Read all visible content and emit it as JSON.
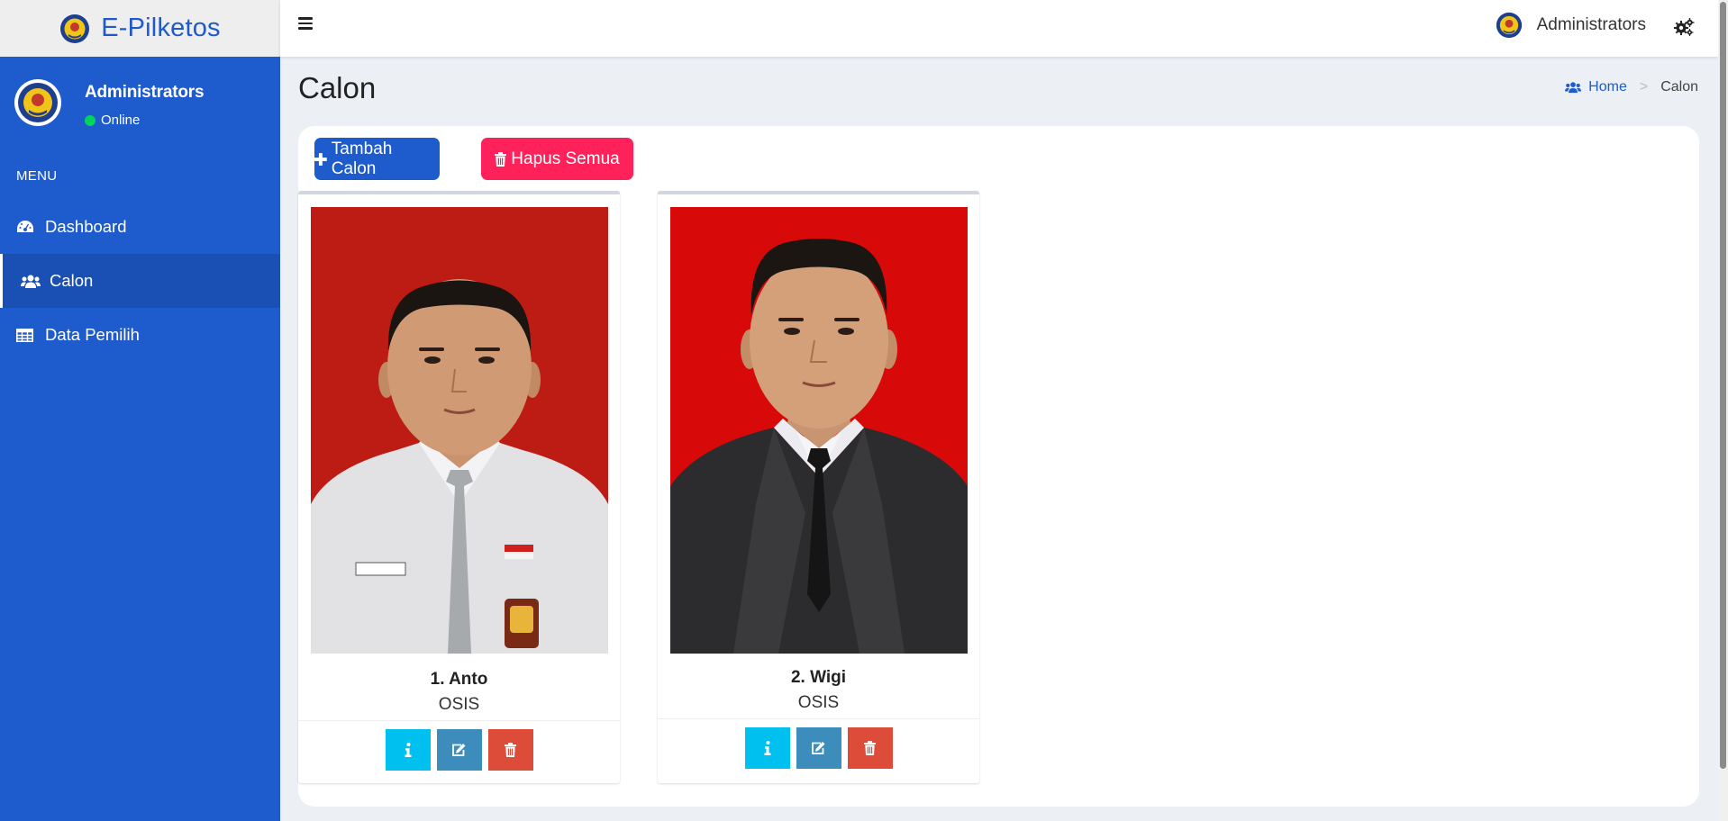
{
  "app": {
    "brand": "E-Pilketos",
    "top_user_name": "Administrators"
  },
  "sidebar": {
    "user_name": "Administrators",
    "user_status": "Online",
    "menu_header": "MENU",
    "items": [
      {
        "label": "Dashboard",
        "icon": "dashboard-icon",
        "active": false
      },
      {
        "label": "Calon",
        "icon": "users-icon",
        "active": true
      },
      {
        "label": "Data Pemilih",
        "icon": "table-icon",
        "active": false
      }
    ]
  },
  "page": {
    "title": "Calon",
    "breadcrumb_home": "Home",
    "breadcrumb_current": "Calon"
  },
  "toolbar": {
    "add_label": "Tambah Calon",
    "delete_all_label": "Hapus Semua"
  },
  "candidates": [
    {
      "name": "1. Anto",
      "org": "OSIS",
      "attire": "white school uniform with grey tie",
      "bg": "#bd1c14"
    },
    {
      "name": "2. Wigi",
      "org": "OSIS",
      "attire": "black suit with black tie",
      "bg": "#d80a09"
    }
  ],
  "colors": {
    "primary": "#1e5bcd",
    "danger_pink": "#ff2159",
    "info": "#00c0ef",
    "edit": "#3c8dbc",
    "delete": "#dd4b39",
    "online": "#00d45c"
  }
}
